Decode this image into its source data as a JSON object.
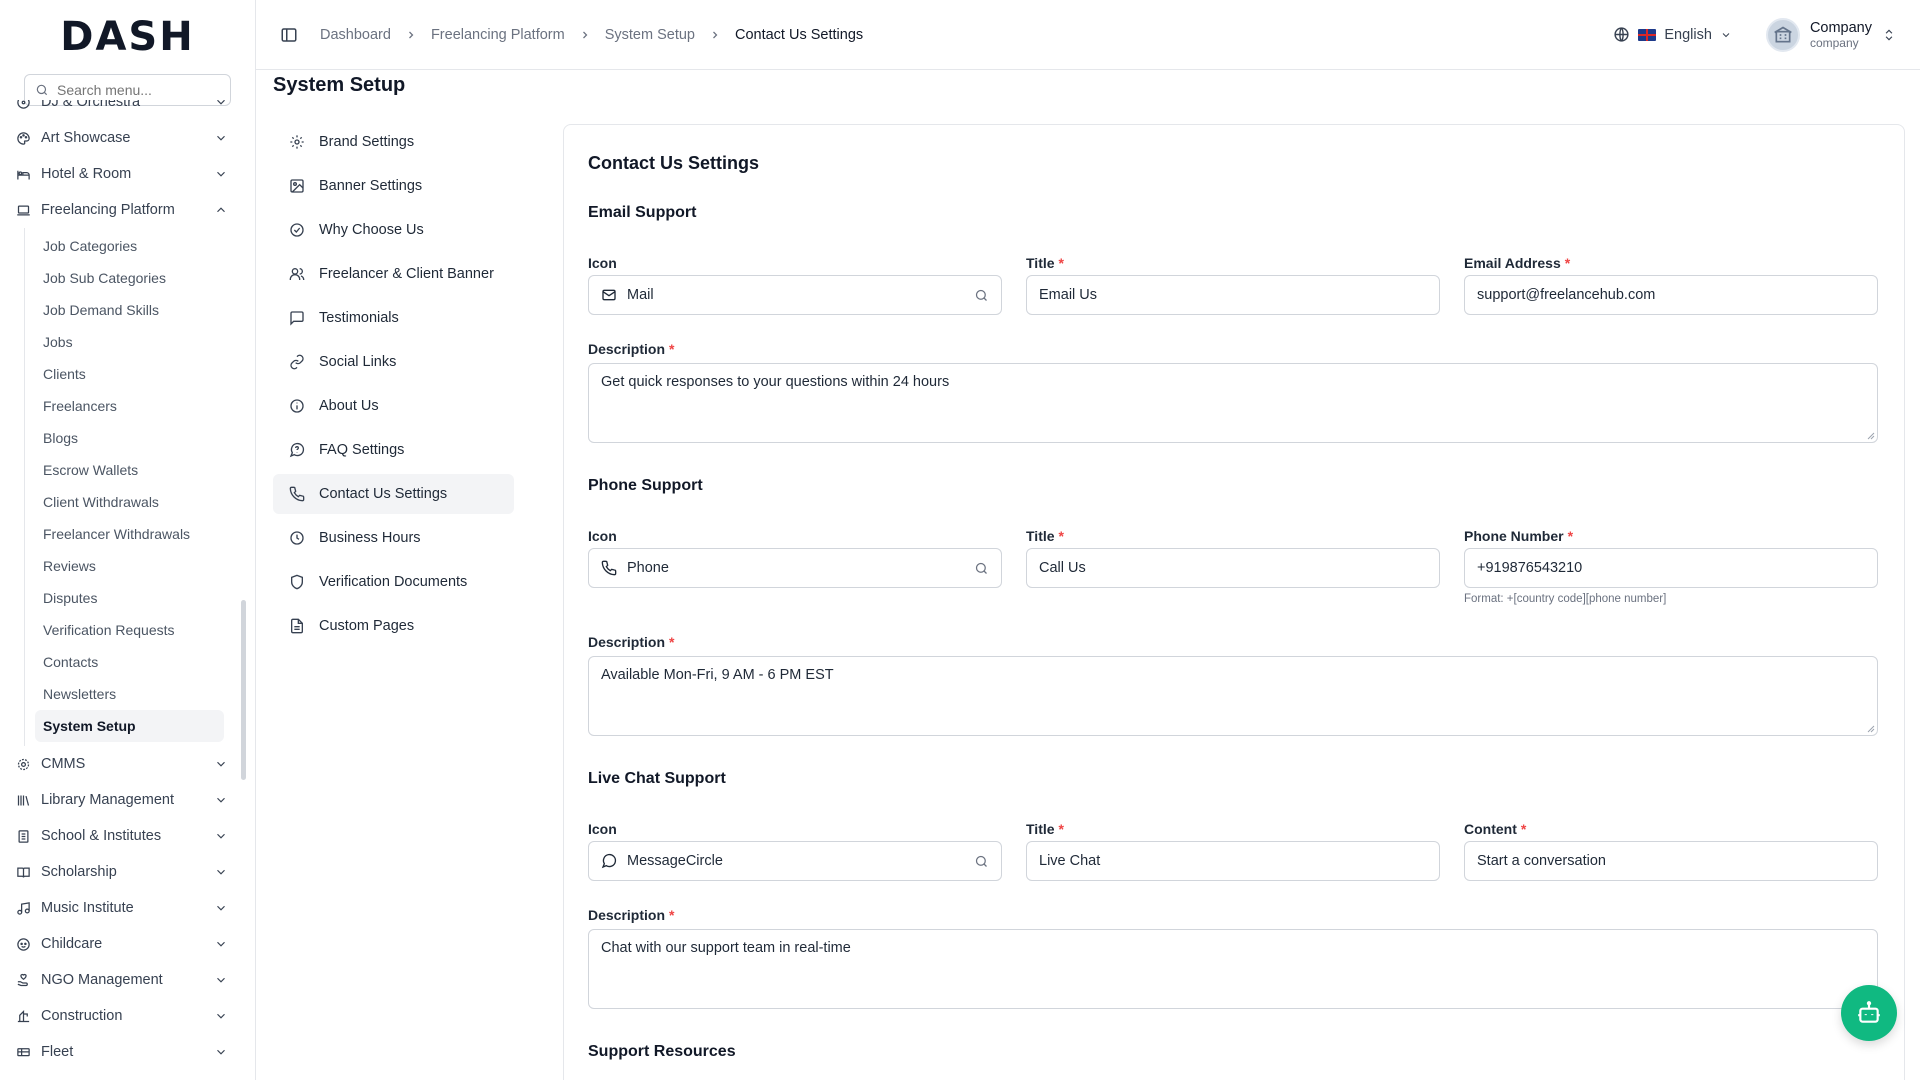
{
  "brand": {
    "logo_text": "DASH"
  },
  "sidebar": {
    "search_placeholder": "Search menu...",
    "top_items": [
      {
        "label": "DJ & Orchestra",
        "icon": "disc-icon"
      },
      {
        "label": "Art Showcase",
        "icon": "palette-icon"
      },
      {
        "label": "Hotel & Room",
        "icon": "bed-icon"
      },
      {
        "label": "Freelancing Platform",
        "icon": "laptop-icon"
      }
    ],
    "sub_items": [
      "Job Categories",
      "Job Sub Categories",
      "Job Demand Skills",
      "Jobs",
      "Clients",
      "Freelancers",
      "Blogs",
      "Escrow Wallets",
      "Client Withdrawals",
      "Freelancer Withdrawals",
      "Reviews",
      "Disputes",
      "Verification Requests",
      "Contacts",
      "Newsletters",
      "System Setup"
    ],
    "active_sub": "System Setup",
    "bottom_items": [
      {
        "label": "CMMS",
        "icon": "cog-icon"
      },
      {
        "label": "Library Management",
        "icon": "library-icon"
      },
      {
        "label": "School & Institutes",
        "icon": "school-icon"
      },
      {
        "label": "Scholarship",
        "icon": "book-open-icon"
      },
      {
        "label": "Music Institute",
        "icon": "music-icon"
      },
      {
        "label": "Childcare",
        "icon": "baby-icon"
      },
      {
        "label": "NGO Management",
        "icon": "hand-heart-icon"
      },
      {
        "label": "Construction",
        "icon": "construction-icon"
      },
      {
        "label": "Fleet",
        "icon": "truck-icon"
      }
    ]
  },
  "header": {
    "breadcrumbs": [
      "Dashboard",
      "Freelancing Platform",
      "System Setup",
      "Contact Us Settings"
    ],
    "language": "English",
    "user_name": "Company",
    "user_role": "company"
  },
  "page": {
    "title": "System Setup"
  },
  "settings_nav": [
    {
      "label": "Brand Settings",
      "icon": "settings-icon"
    },
    {
      "label": "Banner Settings",
      "icon": "image-icon"
    },
    {
      "label": "Why Choose Us",
      "icon": "check-circle-icon"
    },
    {
      "label": "Freelancer & Client Banner",
      "icon": "users-icon"
    },
    {
      "label": "Testimonials",
      "icon": "message-square-icon"
    },
    {
      "label": "Social Links",
      "icon": "link-icon"
    },
    {
      "label": "About Us",
      "icon": "info-icon"
    },
    {
      "label": "FAQ Settings",
      "icon": "help-bubble-icon"
    },
    {
      "label": "Contact Us Settings",
      "icon": "phone-icon"
    },
    {
      "label": "Business Hours",
      "icon": "clock-icon"
    },
    {
      "label": "Verification Documents",
      "icon": "shield-icon"
    },
    {
      "label": "Custom Pages",
      "icon": "file-text-icon"
    }
  ],
  "settings_nav_active": "Contact Us Settings",
  "form": {
    "card_title": "Contact Us Settings",
    "email": {
      "section": "Email Support",
      "icon_label": "Icon",
      "icon_value": "Mail",
      "title_label": "Title",
      "title_value": "Email Us",
      "extra_label": "Email Address",
      "extra_value": "support@freelancehub.com",
      "desc_label": "Description",
      "desc_value": "Get quick responses to your questions within 24 hours"
    },
    "phone": {
      "section": "Phone Support",
      "icon_label": "Icon",
      "icon_value": "Phone",
      "title_label": "Title",
      "title_value": "Call Us",
      "extra_label": "Phone Number",
      "extra_value": "+919876543210",
      "hint": "Format: +[country code][phone number]",
      "desc_label": "Description",
      "desc_value": "Available Mon-Fri, 9 AM - 6 PM EST"
    },
    "chat": {
      "section": "Live Chat Support",
      "icon_label": "Icon",
      "icon_value": "MessageCircle",
      "title_label": "Title",
      "title_value": "Live Chat",
      "extra_label": "Content",
      "extra_value": "Start a conversation",
      "desc_label": "Description",
      "desc_value": "Chat with our support team in real-time"
    },
    "resources_section": "Support Resources",
    "required_mark": "*"
  },
  "colors": {
    "accent": "#10b981",
    "required": "#ef4444",
    "border": "#d1d5db"
  }
}
